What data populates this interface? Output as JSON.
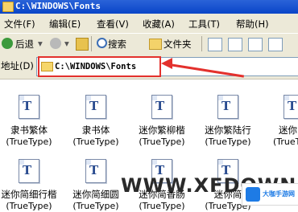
{
  "window": {
    "title": "C:\\WINDOWS\\Fonts"
  },
  "menu": [
    "文件(F)",
    "编辑(E)",
    "查看(V)",
    "收藏(A)",
    "工具(T)",
    "帮助(H)"
  ],
  "toolbar": {
    "back_label": "后退",
    "search_label": "搜索",
    "folders_label": "文件夹"
  },
  "address": {
    "label": "地址(D)",
    "value": "C:\\WINDOWS\\Fonts"
  },
  "fonts": [
    {
      "name": "隶书繁体",
      "type": "(TrueType)"
    },
    {
      "name": "隶书体",
      "type": "(TrueType)"
    },
    {
      "name": "迷你繁柳楷",
      "type": "(TrueType)"
    },
    {
      "name": "迷你繁陆行",
      "type": "(TrueType)"
    },
    {
      "name": "迷你",
      "type": "(TrueT"
    },
    {
      "name": "迷你简细行楷",
      "type": "(TrueType)"
    },
    {
      "name": "迷你简细圆",
      "type": "(TrueType)"
    },
    {
      "name": "迷你简香肠",
      "type": "(TrueType)"
    },
    {
      "name": "迷你简",
      "type": "(TrueType)"
    }
  ],
  "watermark": "WWW.XFDOWN",
  "logo_text": "大咖手游网"
}
